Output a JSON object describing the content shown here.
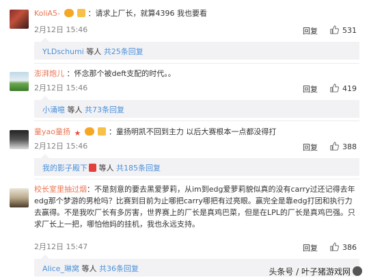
{
  "comments": [
    {
      "user": "KoliA5-",
      "text": "：请求上厂长，就算4396 我也要看",
      "date": "2月12日 15:46",
      "reply_label": "回复",
      "likes": "531",
      "sub": {
        "name": "YLDschumi",
        "mid": " 等人 ",
        "count": "共25条回复"
      }
    },
    {
      "user": "澎湃炮儿",
      "text": "：怀念那个被deft支配的时代。。",
      "date": "2月12日 15:46",
      "reply_label": "回复",
      "likes": "419",
      "sub": {
        "name": "小涌噫",
        "mid": " 等人 ",
        "count": "共73条回复"
      }
    },
    {
      "user": "童yao童扬",
      "text": "：童扬明凯不回到主力 以后大赛根本一点都没得打",
      "date": "2月12日 15:46",
      "reply_label": "回复",
      "likes": "388",
      "sub": {
        "name": "我的影子殿下",
        "mid": " 等人 ",
        "count": "共185条回复"
      }
    },
    {
      "user": "校长室里抽过烟",
      "text": "：不是刻意的要去黑爱萝莉，从im到edg爱萝莉貌似真的没有carry过还记得去年edg那个梦游的男枪吗？比赛到目前为止哪把carry哪把有过亮眼。赢完全是靠edg打团和执行力去赢得。不是我吹厂长有多厉害，世界赛上的厂长是真鸡巴菜，但是在LPL的厂长是真鸡巴强。只求厂长上一把，哪怕他妈的挂机，我也永远支持。",
      "date": "2月12日 15:47",
      "reply_label": "回复",
      "likes": "386",
      "sub": {
        "name": "Alice_琳窝",
        "mid": " 等人 ",
        "count": "共36条回复"
      }
    }
  ],
  "watermark": "头条号 / 叶子猪游戏网",
  "colors": {
    "username": "#eb7350",
    "link": "#4a90d9",
    "subbox": "#f2f2f5",
    "meta": "#808080"
  }
}
